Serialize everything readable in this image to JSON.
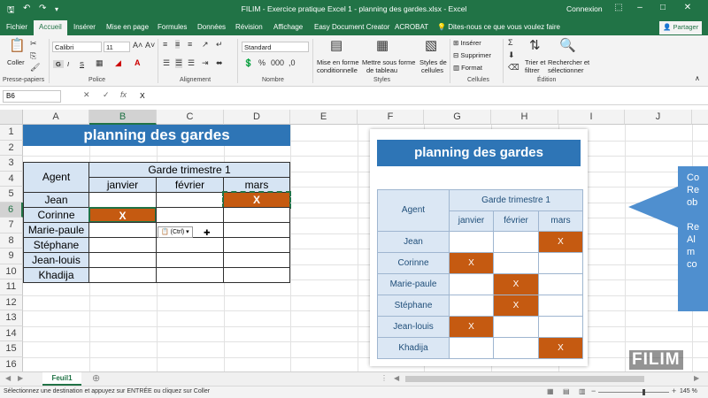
{
  "titlebar": {
    "title": "FILIM - Exercice pratique Excel 1 - planning des gardes.xlsx  -  Excel",
    "user": "Connexion",
    "save_icon": "save-icon",
    "undo_icon": "undo-icon",
    "redo_icon": "redo-icon"
  },
  "tabs": [
    "Fichier",
    "Accueil",
    "Insérer",
    "Mise en page",
    "Formules",
    "Données",
    "Révision",
    "Affichage",
    "Easy Document Creator",
    "ACROBAT"
  ],
  "active_tab": "Accueil",
  "tellme": "Dites-nous ce que vous voulez faire",
  "share": "Partager",
  "ribbon": {
    "paste": "Coller",
    "clipboard": "Presse-papiers",
    "font_name": "Calibri",
    "font_size": "11",
    "bold": "G",
    "italic": "I",
    "underline": "S",
    "font_group": "Police",
    "align_group": "Alignement",
    "number_format": "Standard",
    "number_group": "Nombre",
    "cond_format_1": "Mise en forme",
    "cond_format_2": "conditionnelle",
    "table_format_1": "Mettre sous forme",
    "table_format_2": "de tableau",
    "cell_styles_1": "Styles de",
    "cell_styles_2": "cellules",
    "styles_group": "Styles",
    "insert": "Insérer",
    "delete": "Supprimer",
    "format": "Format",
    "cells_group": "Cellules",
    "sort_1": "Trier et",
    "sort_2": "filtrer",
    "find_1": "Rechercher et",
    "find_2": "sélectionner",
    "edit_group": "Édition"
  },
  "formula_bar": {
    "name_box": "B6",
    "fx": "fx",
    "content": "X"
  },
  "columns": [
    "A",
    "B",
    "C",
    "D",
    "E",
    "F",
    "G",
    "H",
    "I",
    "J"
  ],
  "selected_column": "B",
  "rows": [
    "1",
    "2",
    "3",
    "4",
    "5",
    "6",
    "7",
    "8",
    "9",
    "10",
    "11",
    "12",
    "13",
    "14",
    "15",
    "16"
  ],
  "selected_row": "6",
  "sheet": {
    "title": "planning des gardes",
    "agent_header": "Agent",
    "group_header": "Garde trimestre 1",
    "months": [
      "janvier",
      "février",
      "mars"
    ],
    "agents": [
      "Jean",
      "Corinne",
      "Marie-paule",
      "Stéphane",
      "Jean-louis",
      "Khadija"
    ],
    "marks": {
      "jean_mars": "X",
      "corinne_janvier": "X"
    }
  },
  "paste_tag": "(Ctrl)",
  "reference": {
    "title": "planning des gardes",
    "agent_header": "Agent",
    "group_header": "Garde trimestre 1",
    "months": [
      "janvier",
      "février",
      "mars"
    ],
    "agents": [
      "Jean",
      "Corinne",
      "Marie-paule",
      "Stéphane",
      "Jean-louis",
      "Khadija"
    ],
    "mark": "X",
    "assignments": [
      "mars",
      "janvier",
      "février",
      "février",
      "janvier",
      "mars"
    ]
  },
  "callout_lines": [
    "Co",
    "Re",
    "ob",
    "",
    "Re",
    "Al",
    "m",
    "co"
  ],
  "watermark": "FILIM",
  "sheet_tab": "Feuil1",
  "status": {
    "message": "Sélectionnez une destination et appuyez sur ENTRÉE ou cliquez sur Coller",
    "zoom": "145 %"
  }
}
